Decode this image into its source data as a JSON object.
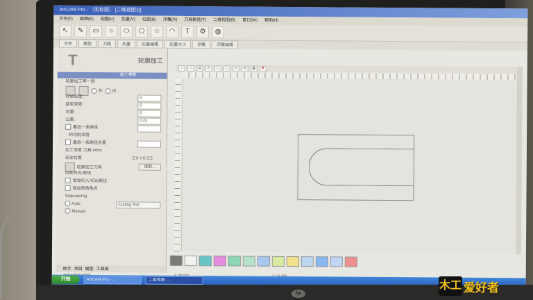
{
  "window": {
    "title": "ArtCAM Pro - （无标题）  [二维视图:0]"
  },
  "menu": [
    "文件(F)",
    "编辑(E)",
    "视图(V)",
    "矢量(V)",
    "位图(B)",
    "浮雕(R)",
    "刀具路径(T)",
    "二维视图(D)",
    "窗口(W)",
    "帮助(H)"
  ],
  "toolbar2_tabs": [
    "文件",
    "模型",
    "刀路",
    "矢量",
    "矢量编辑",
    "矢量大小",
    "浮雕",
    "浮雕编辑"
  ],
  "panel": {
    "title": "轮廓加工",
    "section": "加工参数",
    "subheader": "轮廓加工零一侧",
    "side_outside": "外",
    "side_inside": "内",
    "start_depth_label": "开始深度:",
    "start_depth": "0",
    "finish_depth_label": "结束深度:",
    "finish_depth": "0",
    "allowance_label": "余量:",
    "allowance": "0",
    "tolerance_label": "公差:",
    "tolerance": "0.01",
    "last_pass_label": "最后一条路径",
    "last_pass_sub": "的切削深度",
    "last_allowance_label": "最后一条路径余量",
    "tool_label": "加工深度 刀具:4mm",
    "tool_value": "",
    "safe_z_label": "安全位置",
    "safe_z_value": "Z:0 Y:0 Z:5",
    "finish_tool_label": "轮廓加工刀具",
    "select_button": "选取...",
    "direction_label": "切削方向:顺铣",
    "ramp_label": "增加切入/切出路径",
    "corner_label": "增加倒角角点",
    "sequencing_label": "Sequencing",
    "auto_label": "Auto",
    "auto_value": "Cutting first",
    "manual_label": "Manual",
    "tabs": [
      "助手",
      "项目",
      "模型",
      "工具库"
    ]
  },
  "palette": [
    "#7c7a74",
    "#f2f2f0",
    "#68c5c7",
    "#e58be0",
    "#8dd6b6",
    "#b6e1c8",
    "#a8c7f0",
    "#d6eaa0",
    "#f3e08a",
    "#bcd6f2",
    "#88b8f0",
    "#c1d5f7",
    "#ee9090"
  ],
  "status": {
    "hint": "选择元素进行编辑",
    "x": "X: 90.000",
    "y": "Y: 24.588"
  },
  "taskbar": {
    "start": "开始",
    "items": [
      "ArtCAM Pro - ...",
      "二维视图 - ..."
    ]
  },
  "monitor_brand": "hp",
  "watermark": {
    "logo": "木工",
    "text": "爱好者"
  }
}
